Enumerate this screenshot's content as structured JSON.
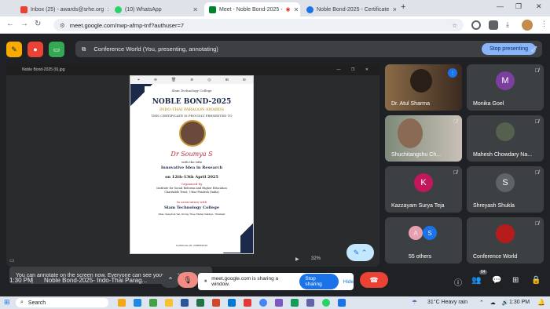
{
  "browser": {
    "tabs": [
      {
        "label": "Inbox (25) - awards@srhe.org",
        "color": "#ea4335",
        "active": false
      },
      {
        "label": "(10) WhatsApp",
        "color": "#25d366",
        "active": false
      },
      {
        "label": "Meet - Noble Bond-2025 -",
        "color": "#00832d",
        "active": true
      },
      {
        "label": "Noble Bond-2025 - Certificate",
        "color": "#1a73e8",
        "active": false
      }
    ],
    "url": "meet.google.com/nwp-afmp-tnf?authuser=7",
    "add_tab": "+"
  },
  "meet": {
    "presenting_label": "Conference World (You, presenting, annotating)",
    "stop_presenting": "Stop presenting",
    "file_name": "Noble Bond-2025 (6).jpg",
    "zoom": "32%",
    "toast": "You can annotate on the screen now. Everyone can see your annotations.",
    "certificate": {
      "org_header": "Slam Technology College",
      "title": "NOBLE BOND-2025",
      "subtitle": "INDO-THAI PARAGON AWARDS",
      "presented": "THIS CERTIFICATE IS PROUDLY PRESENTED TO",
      "name": "Dr Soumya S",
      "with_title": "with the title",
      "award": "Innovative Idea in Research",
      "date": "on 12th-13th April 2025",
      "organized_by": "Organized by",
      "org1": "Institute for Social Reforms and Higher Education",
      "org2": "Charitable Trust, Uttar Pradesh (India)",
      "assoc": "In association with",
      "assoc_org": "Slam Technology College",
      "assoc_addr": "Khao Sanphok Vai, Krong Thep Maha Nakhon, Thailand",
      "cert_no": "Certificate ID: ISRHE2025"
    },
    "participants": [
      {
        "name": "Dr. Atul Sharma",
        "initial": "",
        "color": "#5b4a3a",
        "video": true
      },
      {
        "name": "Monika Goel",
        "initial": "M",
        "color": "#7b3fa0",
        "video": false
      },
      {
        "name": "Shuchitangshu Ch...",
        "initial": "",
        "color": "#6d6d6d",
        "video": true
      },
      {
        "name": "Mahesh Chowdary Na...",
        "initial": "",
        "color": "#5a6b5a",
        "video": false
      },
      {
        "name": "Kazzayam Surya Teja",
        "initial": "K",
        "color": "#c2185b",
        "video": false
      },
      {
        "name": "Shreyash Shukla",
        "initial": "S",
        "color": "#5f6368",
        "video": false
      },
      {
        "name": "55 others",
        "initial": "",
        "color": "#3c4043",
        "video": false
      },
      {
        "name": "Conference World",
        "initial": "",
        "color": "#b71c1c",
        "video": false
      }
    ],
    "others_avatars": [
      "A",
      "S"
    ],
    "time": "1:30 PM",
    "meeting_name": "Noble Bond-2025- Indo-Thai Parag...",
    "share_notice": "meet.google.com is sharing a window.",
    "stop_sharing": "Stop sharing",
    "hide": "Hide",
    "people_count": "64"
  },
  "taskbar": {
    "search": "Search",
    "weather": "31°C  Heavy rain",
    "clock": "1:30 PM"
  }
}
